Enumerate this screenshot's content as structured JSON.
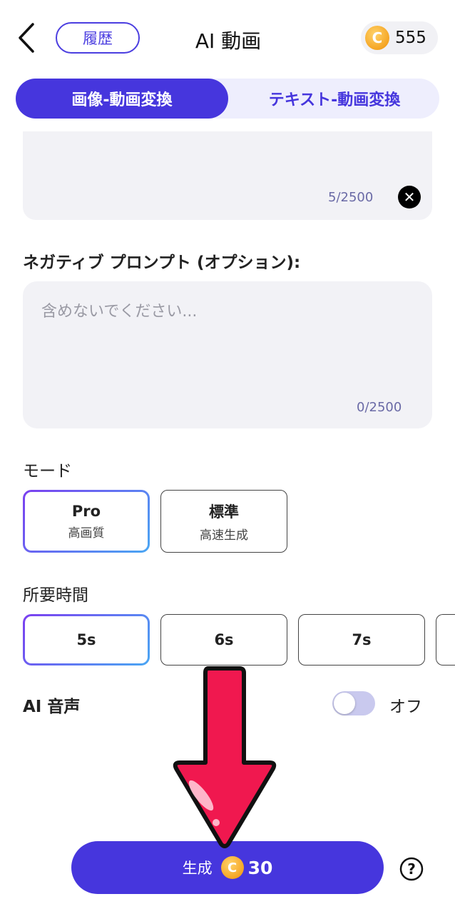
{
  "header": {
    "history_label": "履歴",
    "title": "AI 動画",
    "coins": "555",
    "coin_symbol": "C"
  },
  "tabs": [
    {
      "label": "画像-動画変換",
      "active": true
    },
    {
      "label": "テキスト-動画変換",
      "active": false
    }
  ],
  "prompt": {
    "counter": "5/2500"
  },
  "negative_prompt": {
    "label": "ネガティブ プロンプト (オプション):",
    "placeholder": "含めないでください...",
    "value": "",
    "counter": "0/2500"
  },
  "mode": {
    "label": "モード",
    "options": [
      {
        "title": "Pro",
        "subtitle": "高画質",
        "selected": true
      },
      {
        "title": "標準",
        "subtitle": "高速生成",
        "selected": false
      }
    ]
  },
  "duration": {
    "label": "所要時間",
    "options": [
      {
        "label": "5s",
        "selected": true
      },
      {
        "label": "6s",
        "selected": false
      },
      {
        "label": "7s",
        "selected": false
      }
    ]
  },
  "ai_voice": {
    "label": "AI 音声",
    "state": "オフ",
    "on": false
  },
  "generate": {
    "label": "生成",
    "cost": "30"
  },
  "colors": {
    "accent": "#4636dd",
    "coin": "#f5a524",
    "annotation_arrow": "#f0184f"
  },
  "icons": [
    "back-chevron-icon",
    "coin-icon",
    "clear-icon",
    "help-icon",
    "annotation-arrow"
  ]
}
